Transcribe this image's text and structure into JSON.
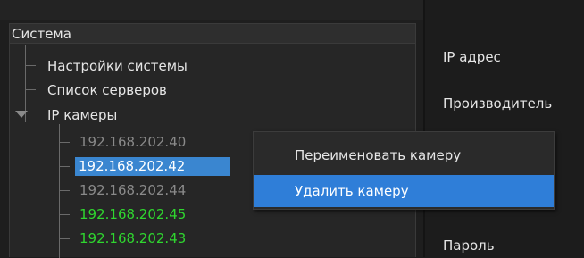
{
  "tree": {
    "root_label": "Система",
    "items": [
      {
        "label": "Настройки системы"
      },
      {
        "label": "Список серверов"
      },
      {
        "label": "IP камеры",
        "expanded": true
      }
    ],
    "cameras": [
      {
        "ip": "192.168.202.40",
        "state": "dim"
      },
      {
        "ip": "192.168.202.42",
        "state": "selected"
      },
      {
        "ip": "192.168.202.44",
        "state": "dim"
      },
      {
        "ip": "192.168.202.45",
        "state": "green"
      },
      {
        "ip": "192.168.202.43",
        "state": "green"
      }
    ]
  },
  "form": {
    "ip_label": "IP адрес",
    "manufacturer_label": "Производитель",
    "password_label": "Пароль"
  },
  "context_menu": {
    "items": [
      {
        "label": "Переименовать камеру"
      },
      {
        "label": "Удалить камеру",
        "highlighted": true
      }
    ]
  },
  "colors": {
    "selection": "#3a86d0",
    "menu_highlight": "#2f7ed8",
    "online_camera": "#2fd62f",
    "offline_camera": "#8a8a8a"
  }
}
